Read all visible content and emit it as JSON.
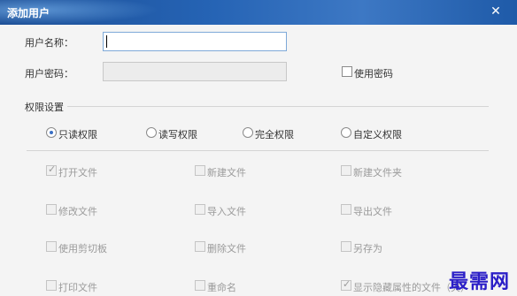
{
  "window": {
    "title": "添加用户",
    "close_glyph": "✕"
  },
  "form": {
    "username_label": "用户名称：",
    "username_value": "",
    "password_label": "用户密码：",
    "password_value": "",
    "use_password_label": "使用密码",
    "use_password_checked": false
  },
  "permissions": {
    "group_title": "权限设置",
    "modes": [
      {
        "label": "只读权限",
        "checked": true
      },
      {
        "label": "读写权限",
        "checked": false
      },
      {
        "label": "完全权限",
        "checked": false
      },
      {
        "label": "自定义权限",
        "checked": false
      }
    ],
    "options": [
      {
        "label": "打开文件",
        "checked": true
      },
      {
        "label": "新建文件",
        "checked": false
      },
      {
        "label": "新建文件夹",
        "checked": false
      },
      {
        "label": "修改文件",
        "checked": false
      },
      {
        "label": "导入文件",
        "checked": false
      },
      {
        "label": "导出文件",
        "checked": false
      },
      {
        "label": "使用剪切板",
        "checked": false
      },
      {
        "label": "删除文件",
        "checked": false
      },
      {
        "label": "另存为",
        "checked": false
      },
      {
        "label": "打印文件",
        "checked": false
      },
      {
        "label": "重命名",
        "checked": false
      },
      {
        "label": "显示隐藏属性的文件（夹）",
        "checked": true
      }
    ]
  },
  "watermark": "最需网",
  "colors": {
    "titlebar": "#2563b4",
    "input_border": "#7ea9d8",
    "watermark": "#2b1fc7"
  }
}
